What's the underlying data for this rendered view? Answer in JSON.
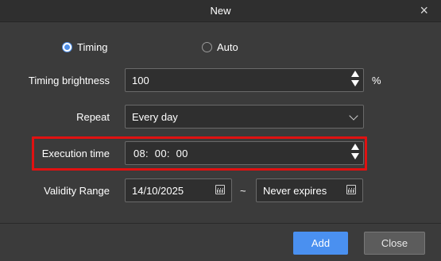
{
  "window": {
    "title": "New",
    "close_glyph": "×"
  },
  "mode": {
    "options": [
      {
        "label": "Timing",
        "selected": true
      },
      {
        "label": "Auto",
        "selected": false
      }
    ]
  },
  "brightness": {
    "label": "Timing brightness",
    "value": "100",
    "unit": "%"
  },
  "repeat": {
    "label": "Repeat",
    "value": "Every day"
  },
  "execution": {
    "label": "Execution time",
    "value": "08:  00:  00"
  },
  "validity": {
    "label": "Validity Range",
    "start": "14/10/2025",
    "separator": "~",
    "end": "Never expires"
  },
  "buttons": {
    "add": "Add",
    "close": "Close"
  },
  "colors": {
    "accent": "#4a90f0",
    "highlight": "#e01111",
    "background": "#3b3b3b"
  }
}
